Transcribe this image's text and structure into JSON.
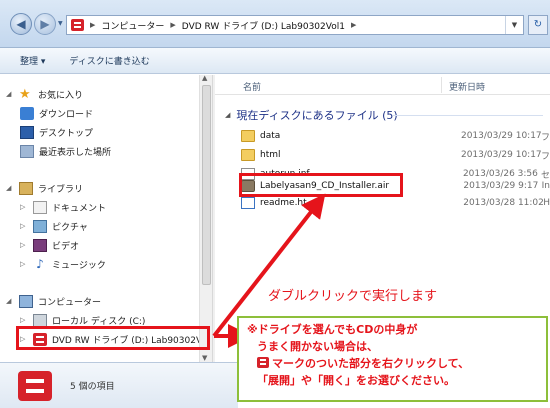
{
  "window": {
    "breadcrumb": [
      "コンピューター",
      "DVD RW ドライブ (D:) Lab90302Vol1"
    ]
  },
  "toolbar": {
    "organize": "整理 ▾",
    "burn": "ディスクに書き込む"
  },
  "sidebar": {
    "favorites": {
      "label": "お気に入り",
      "items": [
        "ダウンロード",
        "デスクトップ",
        "最近表示した場所"
      ]
    },
    "libraries": {
      "label": "ライブラリ",
      "items": [
        "ドキュメント",
        "ピクチャ",
        "ビデオ",
        "ミュージック"
      ]
    },
    "computer": {
      "label": "コンピューター",
      "items": [
        "ローカル ディスク (C:)",
        "DVD RW ドライブ (D:) Lab90302Vo"
      ]
    }
  },
  "content": {
    "column_name": "名前",
    "column_date": "更新日時",
    "group_label": "現在ディスクにあるファイル (5)",
    "files": [
      {
        "name": "data",
        "date": "2013/03/29 10:17",
        "type": "フ"
      },
      {
        "name": "html",
        "date": "2013/03/29 10:17",
        "type": "フ"
      },
      {
        "name": "autorun.inf",
        "date": "2013/03/26 3:56",
        "type": "セ"
      },
      {
        "name": "Labelyasan9_CD_Installer.air",
        "date": "2013/03/29 9:17",
        "type": "In"
      },
      {
        "name": "readme.ht",
        "date": "2013/03/28 11:02",
        "type": "H"
      }
    ]
  },
  "details": {
    "item_count": "5 個の項目"
  },
  "annotation": {
    "callout": "ダブルクリックで実行します",
    "note_lines": [
      "※ドライブを選んでもCDの中身が",
      "うまく開かない場合は、",
      "マークのついた部分を右クリックして、",
      "「展開」や「開く」をお選びください。"
    ]
  },
  "colors": {
    "highlight": "#e5141b",
    "note_border": "#8dbf3a",
    "drive_red": "#d6222a"
  }
}
